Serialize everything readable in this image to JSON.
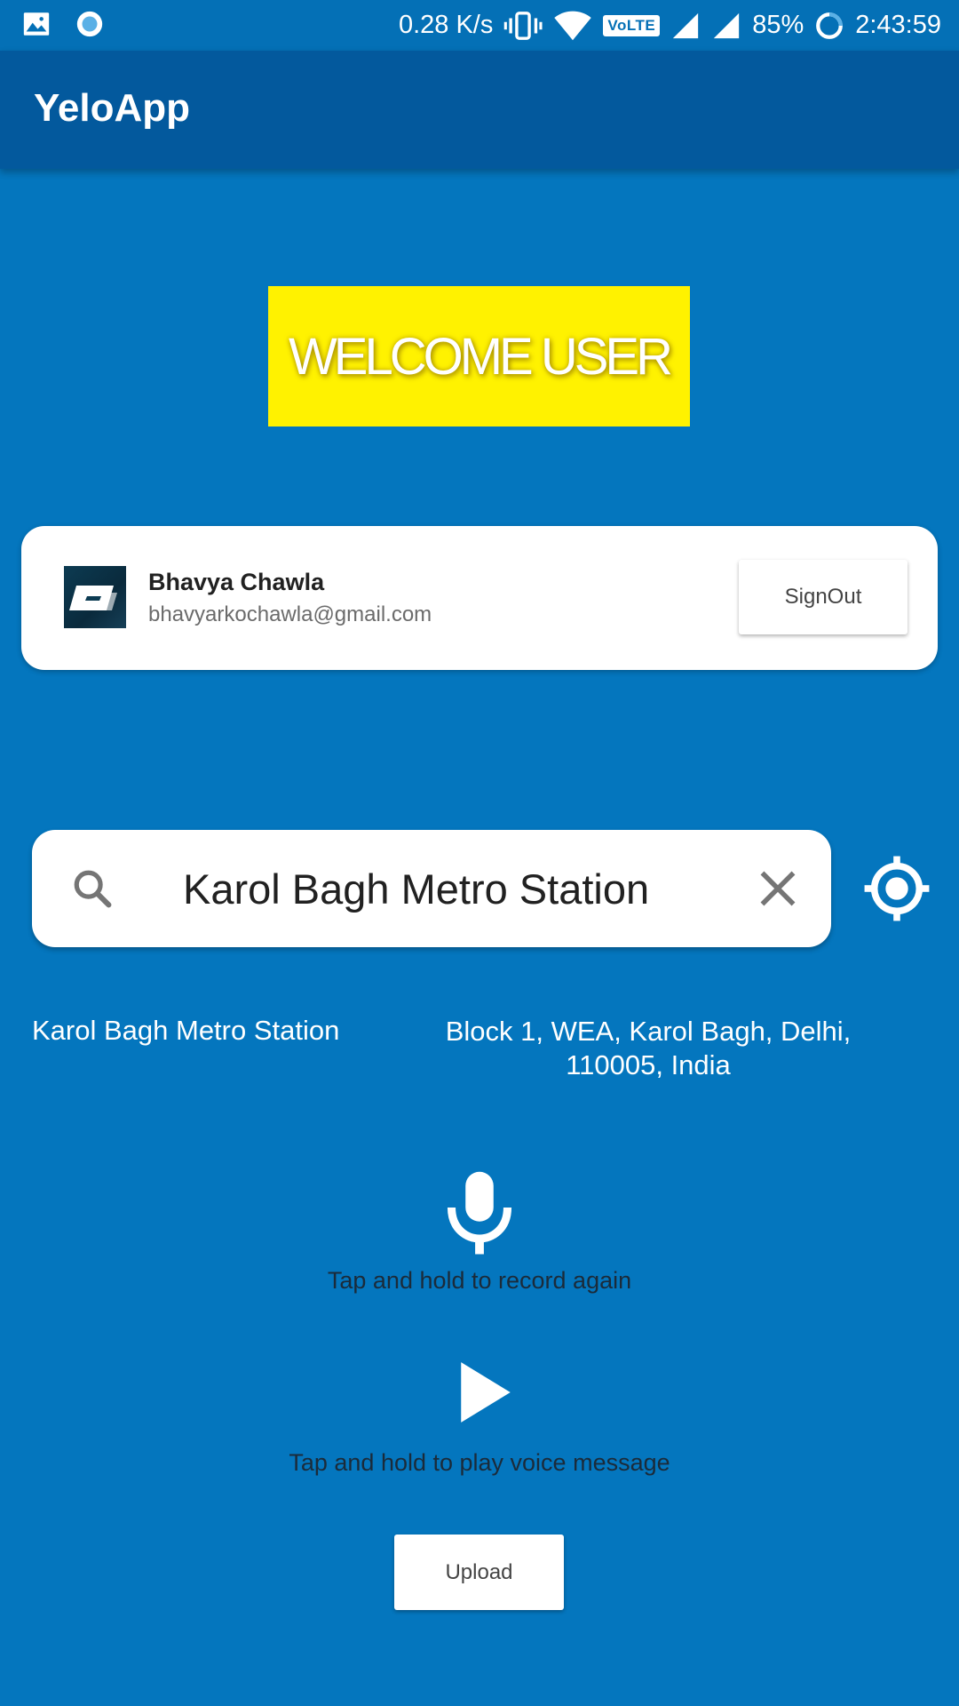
{
  "status_bar": {
    "network_speed": "0.28 K/s",
    "volte_label": "VoLTE",
    "battery": "85%",
    "time": "2:43:59",
    "icons": [
      "gallery-icon",
      "sync-icon",
      "vibrate-icon",
      "wifi-icon",
      "volte-icon",
      "signal-icon",
      "signal-icon",
      "battery-icon"
    ]
  },
  "app_bar": {
    "title": "YeloApp"
  },
  "welcome": {
    "text": "WELCOME USER",
    "background_color": "#FFF200"
  },
  "user": {
    "name": "Bhavya Chawla",
    "email": "bhavyarkochawla@gmail.com",
    "signout_label": "SignOut"
  },
  "search": {
    "value": "Karol Bagh Metro Station",
    "icons": [
      "search-icon",
      "clear-icon",
      "my-location-icon"
    ]
  },
  "result": {
    "place_name": "Karol Bagh Metro Station",
    "address_line1": "Block 1, WEA, Karol Bagh, Delhi,",
    "address_line2": "110005, India"
  },
  "voice": {
    "record_hint": "Tap and hold to record again",
    "play_hint": "Tap and hold to play voice message",
    "icons": [
      "mic-icon",
      "play-icon"
    ]
  },
  "upload": {
    "label": "Upload"
  },
  "colors": {
    "background": "#0476BE",
    "app_bar": "#03599D",
    "status_bar": "#0470B6"
  }
}
